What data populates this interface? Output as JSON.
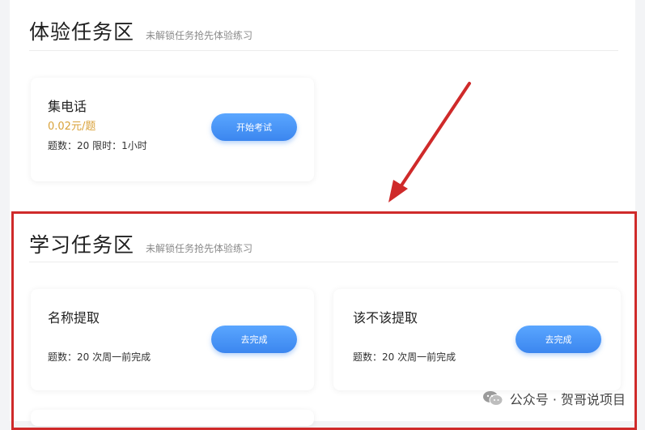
{
  "experience_section": {
    "title": "体验任务区",
    "subtitle": "未解锁任务抢先体验练习",
    "cards": [
      {
        "name": "集电话",
        "price": "0.02元/题",
        "meta": "题数：20 限时：1小时",
        "button": "开始考试"
      }
    ]
  },
  "study_section": {
    "title": "学习任务区",
    "subtitle": "未解锁任务抢先体验练习",
    "cards": [
      {
        "name": "名称提取",
        "meta": "题数：20 次周一前完成",
        "button": "去完成"
      },
      {
        "name": "该不该提取",
        "meta": "题数：20 次周一前完成",
        "button": "去完成"
      }
    ]
  },
  "annotation": {
    "highlight_color": "#cf2a2a"
  },
  "watermark": {
    "icon": "wechat-icon",
    "text": "公众号 · 贺哥说项目"
  },
  "colors": {
    "button_blue": "#3b86ef",
    "price_gold": "#d9a23a"
  }
}
